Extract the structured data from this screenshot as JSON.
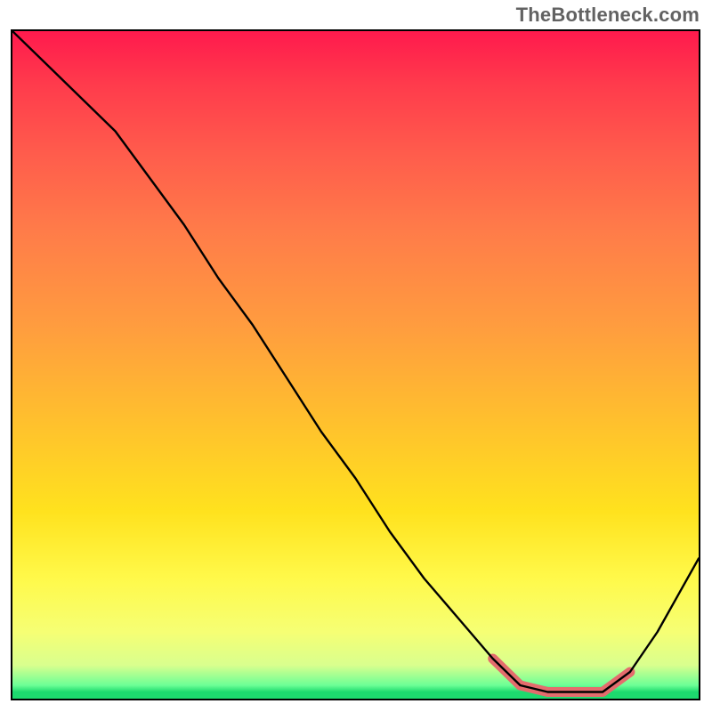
{
  "watermark": "TheBottleneck.com",
  "chart_data": {
    "type": "line",
    "title": "",
    "xlabel": "",
    "ylabel": "",
    "xlim": [
      0,
      100
    ],
    "ylim": [
      0,
      100
    ],
    "grid": false,
    "description": "Single bottleneck-style curve over a rainbow heat gradient. The black line starts at the top-left (very high), falls steeply and almost linearly across most of the width, reaches a flat minimum near the bottom around x≈75–88, then rises toward the right edge. A salmon overlay marks the minimum region.",
    "series": [
      {
        "name": "bottleneck-curve",
        "color": "#000000",
        "x": [
          0,
          5,
          10,
          15,
          20,
          25,
          30,
          35,
          40,
          45,
          50,
          55,
          60,
          65,
          70,
          74,
          78,
          82,
          86,
          90,
          94,
          100
        ],
        "y": [
          100,
          95,
          90,
          85,
          78,
          71,
          63,
          56,
          48,
          40,
          33,
          25,
          18,
          12,
          6,
          2,
          1,
          1,
          1,
          4,
          10,
          21
        ]
      },
      {
        "name": "minimum-highlight",
        "color": "#e46c6d",
        "x": [
          70,
          74,
          78,
          82,
          86,
          90
        ],
        "y": [
          6,
          2,
          1,
          1,
          1,
          4
        ]
      }
    ],
    "colors": {
      "gradient_top": "#ff1a4d",
      "gradient_mid": "#ffe21e",
      "gradient_bottom": "#1dda6e",
      "curve": "#000000",
      "highlight": "#e46c6d"
    }
  }
}
